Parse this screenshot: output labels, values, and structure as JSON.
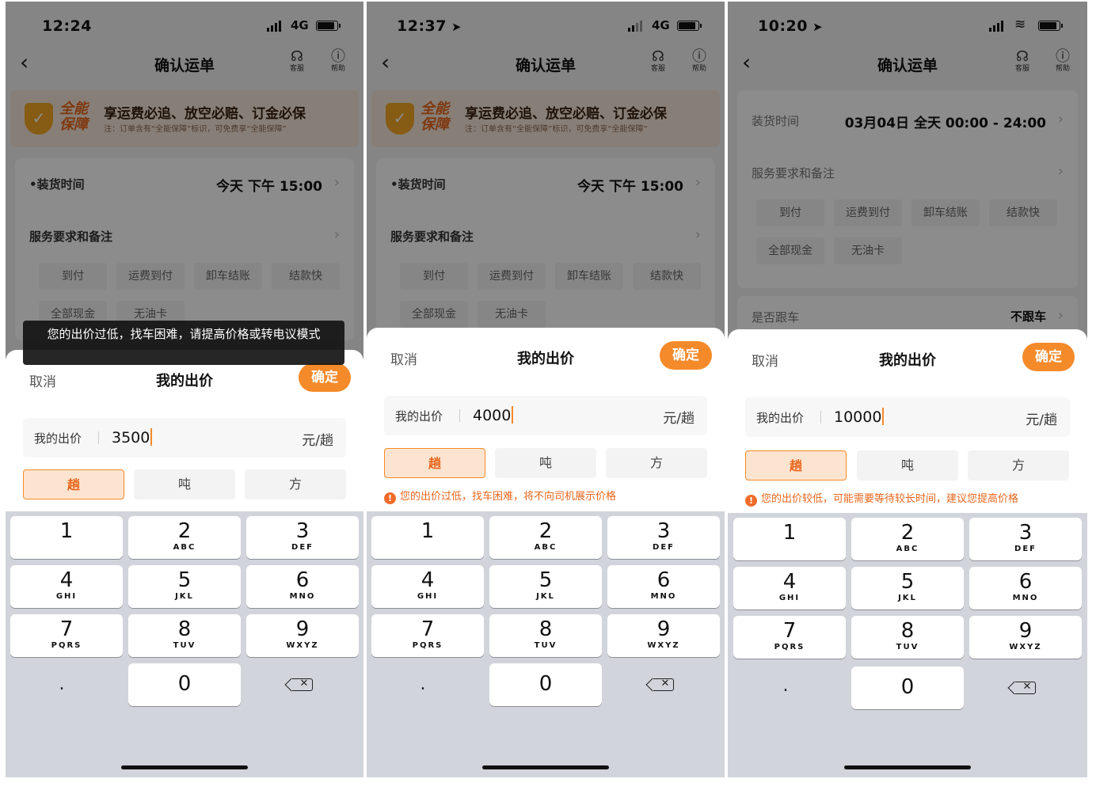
{
  "phones": [
    {
      "status": {
        "time": "12:24",
        "network": "4G"
      },
      "nav": {
        "title": "确认运单",
        "service": "客服",
        "help": "帮助"
      },
      "banner": {
        "brand": "全能保障",
        "headline": "享运费必追、放空必赔、订金必保",
        "sub": "注：订单含有“全能保障”标识，可免费享“全能保障”"
      },
      "form": {
        "load_time_label": "•装货时间",
        "load_time_value": "今天 下午 15:00",
        "service_label": "服务要求和备注",
        "chips": [
          "到付",
          "运费到付",
          "卸车结账",
          "结款快",
          "全部现金",
          "无油卡"
        ]
      },
      "toast": "您的出价过低，找车困难，请提高价格或转电议模式",
      "sheet": {
        "cancel": "取消",
        "title": "我的出价",
        "confirm": "确定",
        "input_label": "我的出价",
        "input_value": "3500",
        "input_unit": "元/趟",
        "units": [
          "趟",
          "吨",
          "方"
        ],
        "selected_unit": "趟"
      }
    },
    {
      "status": {
        "time": "12:37",
        "network": "4G"
      },
      "nav": {
        "title": "确认运单",
        "service": "客服",
        "help": "帮助"
      },
      "banner": {
        "brand": "全能保障",
        "headline": "享运费必追、放空必赔、订金必保",
        "sub": "注：订单含有“全能保障”标识，可免费享“全能保障”"
      },
      "form": {
        "load_time_label": "•装货时间",
        "load_time_value": "今天 下午 15:00",
        "service_label": "服务要求和备注",
        "chips": [
          "到付",
          "运费到付",
          "卸车结账",
          "结款快",
          "全部现金",
          "无油卡"
        ]
      },
      "sheet": {
        "cancel": "取消",
        "title": "我的出价",
        "confirm": "确定",
        "input_label": "我的出价",
        "input_value": "4000",
        "input_unit": "元/趟",
        "units": [
          "趟",
          "吨",
          "方"
        ],
        "selected_unit": "趟",
        "warning": "您的出价过低，找车困难，将不向司机展示价格"
      }
    },
    {
      "status": {
        "time": "10:20"
      },
      "nav": {
        "title": "确认运单",
        "service": "客服",
        "help": "帮助"
      },
      "form": {
        "load_time_label": "装货时间",
        "load_time_value": "03月04日 全天 00:00 - 24:00",
        "service_label": "服务要求和备注",
        "chips": [
          "到付",
          "运费到付",
          "卸车结账",
          "结款快",
          "全部现金",
          "无油卡"
        ],
        "follow_label": "是否跟车",
        "follow_value": "不跟车"
      },
      "sheet": {
        "cancel": "取消",
        "title": "我的出价",
        "confirm": "确定",
        "input_label": "我的出价",
        "input_value": "10000",
        "input_unit": "元/趟",
        "units": [
          "趟",
          "吨",
          "方"
        ],
        "selected_unit": "趟",
        "warning": "您的出价较低，可能需要等待较长时间，建议您提高价格"
      }
    }
  ],
  "keypad": {
    "keys": [
      {
        "num": "1",
        "letters": ""
      },
      {
        "num": "2",
        "letters": "ABC"
      },
      {
        "num": "3",
        "letters": "DEF"
      },
      {
        "num": "4",
        "letters": "GHI"
      },
      {
        "num": "5",
        "letters": "JKL"
      },
      {
        "num": "6",
        "letters": "MNO"
      },
      {
        "num": "7",
        "letters": "PQRS"
      },
      {
        "num": "8",
        "letters": "TUV"
      },
      {
        "num": "9",
        "letters": "WXYZ"
      }
    ],
    "dot": ".",
    "zero": "0"
  },
  "colors": {
    "accent": "#f58a2a",
    "warning": "#e8661c",
    "keypad_bg": "#d1d4da"
  }
}
